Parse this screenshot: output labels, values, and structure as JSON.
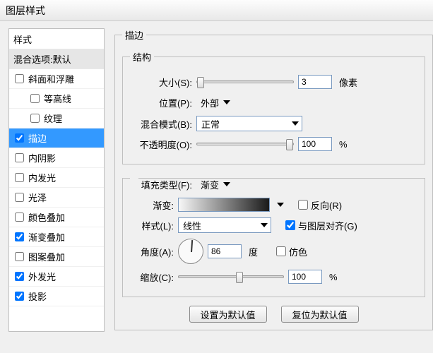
{
  "window": {
    "title": "图层样式"
  },
  "sidebar": {
    "header": "样式",
    "blend": "混合选项:默认",
    "items": [
      {
        "label": "斜面和浮雕",
        "checked": false,
        "selected": false,
        "indent": false
      },
      {
        "label": "等高线",
        "checked": false,
        "selected": false,
        "indent": true
      },
      {
        "label": "纹理",
        "checked": false,
        "selected": false,
        "indent": true
      },
      {
        "label": "描边",
        "checked": true,
        "selected": true,
        "indent": false
      },
      {
        "label": "内阴影",
        "checked": false,
        "selected": false,
        "indent": false
      },
      {
        "label": "内发光",
        "checked": false,
        "selected": false,
        "indent": false
      },
      {
        "label": "光泽",
        "checked": false,
        "selected": false,
        "indent": false
      },
      {
        "label": "颜色叠加",
        "checked": false,
        "selected": false,
        "indent": false
      },
      {
        "label": "渐变叠加",
        "checked": true,
        "selected": false,
        "indent": false
      },
      {
        "label": "图案叠加",
        "checked": false,
        "selected": false,
        "indent": false
      },
      {
        "label": "外发光",
        "checked": true,
        "selected": false,
        "indent": false
      },
      {
        "label": "投影",
        "checked": true,
        "selected": false,
        "indent": false
      }
    ]
  },
  "panel": {
    "title": "描边",
    "structure": {
      "title": "结构",
      "size_label": "大小(S):",
      "size_value": "3",
      "size_unit": "像素",
      "position_label": "位置(P):",
      "position_value": "外部",
      "blend_label": "混合模式(B):",
      "blend_value": "正常",
      "opacity_label": "不透明度(O):",
      "opacity_value": "100",
      "opacity_unit": "%"
    },
    "fill": {
      "fill_type_label": "填充类型(F):",
      "fill_type_value": "渐变",
      "gradient_label": "渐变:",
      "reverse_label": "反向(R)",
      "reverse_checked": false,
      "style_label": "样式(L):",
      "style_value": "线性",
      "align_label": "与图层对齐(G)",
      "align_checked": true,
      "angle_label": "角度(A):",
      "angle_value": "86",
      "angle_unit": "度",
      "dither_label": "仿色",
      "dither_checked": false,
      "scale_label": "缩放(C):",
      "scale_value": "100",
      "scale_unit": "%"
    },
    "buttons": {
      "make_default": "设置为默认值",
      "reset_default": "复位为默认值"
    }
  }
}
